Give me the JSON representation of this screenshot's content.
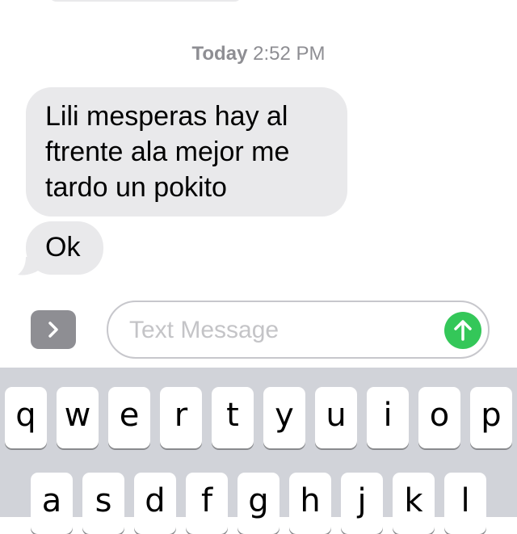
{
  "conversation": {
    "timestamp_day": "Today",
    "timestamp_time": "2:52 PM",
    "messages": [
      {
        "sender": "other",
        "lines": [
          "Lili mesperas hay al",
          "ftrente ala mejor me",
          "tardo un pokito"
        ]
      },
      {
        "sender": "other",
        "lines": [
          "Ok"
        ]
      }
    ]
  },
  "composer": {
    "placeholder": "Text Message",
    "expand_icon": "chevron-right-icon",
    "send_icon": "arrow-up-icon"
  },
  "keyboard": {
    "row1": [
      "q",
      "w",
      "e",
      "r",
      "t",
      "y",
      "u",
      "i",
      "o",
      "p"
    ],
    "row2": [
      "a",
      "s",
      "d",
      "f",
      "g",
      "h",
      "j",
      "k",
      "l"
    ]
  },
  "colors": {
    "bubble_gray": "#e9e9eb",
    "send_green": "#34c759",
    "keyboard_bg": "#d1d3d9",
    "timestamp_gray": "#8e8e93"
  }
}
